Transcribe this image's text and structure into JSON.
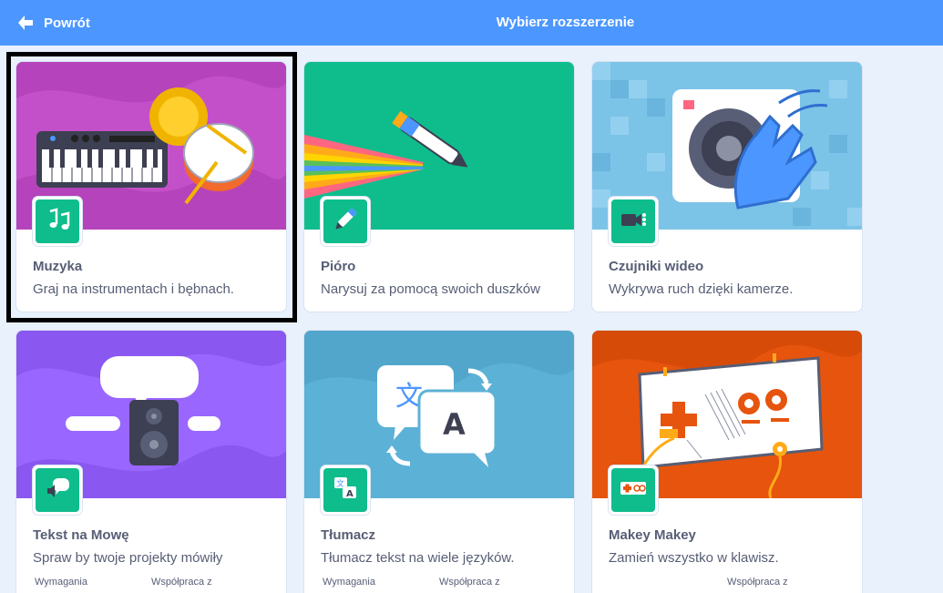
{
  "header": {
    "back_label": "Powrót",
    "title": "Wybierz rozszerzenie",
    "bg_color": "#4c97ff"
  },
  "extensions": [
    {
      "name": "Muzyka",
      "description": "Graj na instrumentach i bębnach.",
      "icon": "music-notes-icon",
      "selected": true
    },
    {
      "name": "Pióro",
      "description": "Narysuj za pomocą swoich duszków",
      "icon": "pen-icon"
    },
    {
      "name": "Czujniki wideo",
      "description": "Wykrywa ruch dzięki kamerze.",
      "icon": "video-camera-icon"
    },
    {
      "name": "Tekst na Mowę",
      "description": "Spraw by twoje projekty mówiły",
      "icon": "speech-bubble-icon",
      "footer": {
        "requirements": "Wymagania",
        "collaboration": "Współpraca z"
      }
    },
    {
      "name": "Tłumacz",
      "description": "Tłumacz tekst na wiele języków.",
      "icon": "translate-icon",
      "footer": {
        "requirements": "Wymagania",
        "collaboration": "Współpraca z"
      }
    },
    {
      "name": "Makey Makey",
      "description": "Zamień wszystko w klawisz.",
      "icon": "makey-makey-icon",
      "footer": {
        "collaboration": "Współpraca z"
      }
    }
  ],
  "colors": {
    "accent": "#4c97ff",
    "extension_green": "#0fbd8c",
    "text": "#575e75"
  }
}
